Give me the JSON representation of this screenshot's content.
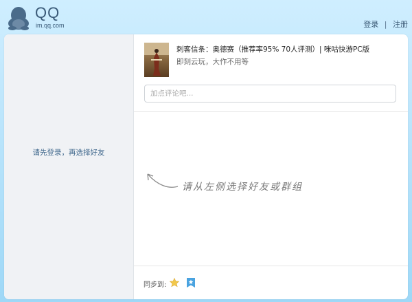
{
  "header": {
    "logo_title": "QQ",
    "logo_subtitle": "im.qq.com",
    "login_label": "登录",
    "separator": "|",
    "register_label": "注册"
  },
  "sidebar": {
    "hint": "请先登录，再选择好友"
  },
  "game_card": {
    "title": "刺客信条：奥德赛（推荐率95% 70人评测）| 咪咕快游PC版",
    "subtitle": "即刻云玩，大作不用等"
  },
  "comment": {
    "placeholder": "加点评论吧..."
  },
  "content": {
    "hint": "请从左侧选择好友或群组"
  },
  "footer": {
    "sync_label": "同步到:"
  },
  "icons": {
    "logo": "qq-penguin-icon",
    "sync_1": "star-icon",
    "sync_2": "bookmark-star-icon"
  },
  "colors": {
    "accent_link": "#426a8e",
    "star": "#f2c84b",
    "bookmark": "#4aa3e0"
  }
}
